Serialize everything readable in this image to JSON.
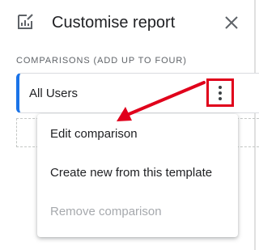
{
  "header": {
    "icon": "report-customise-icon",
    "title": "Customise report",
    "close_icon": "close-icon"
  },
  "comparisons": {
    "section_label": "COMPARISONS (ADD UP TO FOUR)",
    "items": [
      {
        "label": "All Users",
        "accent_color": "#1a73e8"
      }
    ],
    "more_icon": "more-vert-icon"
  },
  "menu": {
    "items": [
      {
        "label": "Edit comparison",
        "enabled": true
      },
      {
        "label": "Create new from this template",
        "enabled": true
      },
      {
        "label": "Remove comparison",
        "enabled": false
      }
    ]
  },
  "annotation": {
    "color": "#e0001b"
  }
}
